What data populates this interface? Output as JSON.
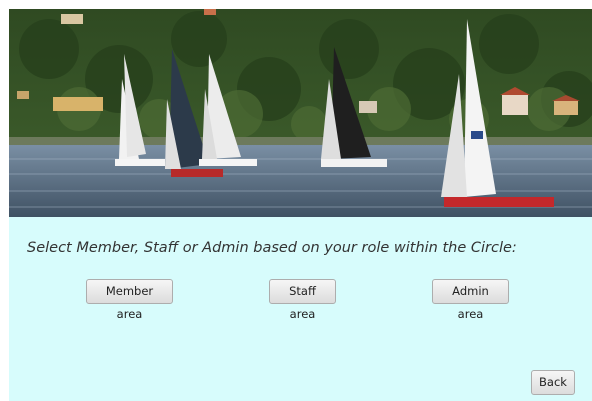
{
  "banner": {
    "image_name": "sailboats-on-lake-photo"
  },
  "main": {
    "prompt": "Select Member, Staff or Admin based on your role within the Circle:",
    "buttons": {
      "member": "Member area",
      "staff": "Staff area",
      "admin": "Admin area"
    },
    "back": "Back"
  },
  "colors": {
    "panel_background": "#d7fcfc",
    "button_border": "#adadad",
    "prompt_text": "#333333"
  }
}
